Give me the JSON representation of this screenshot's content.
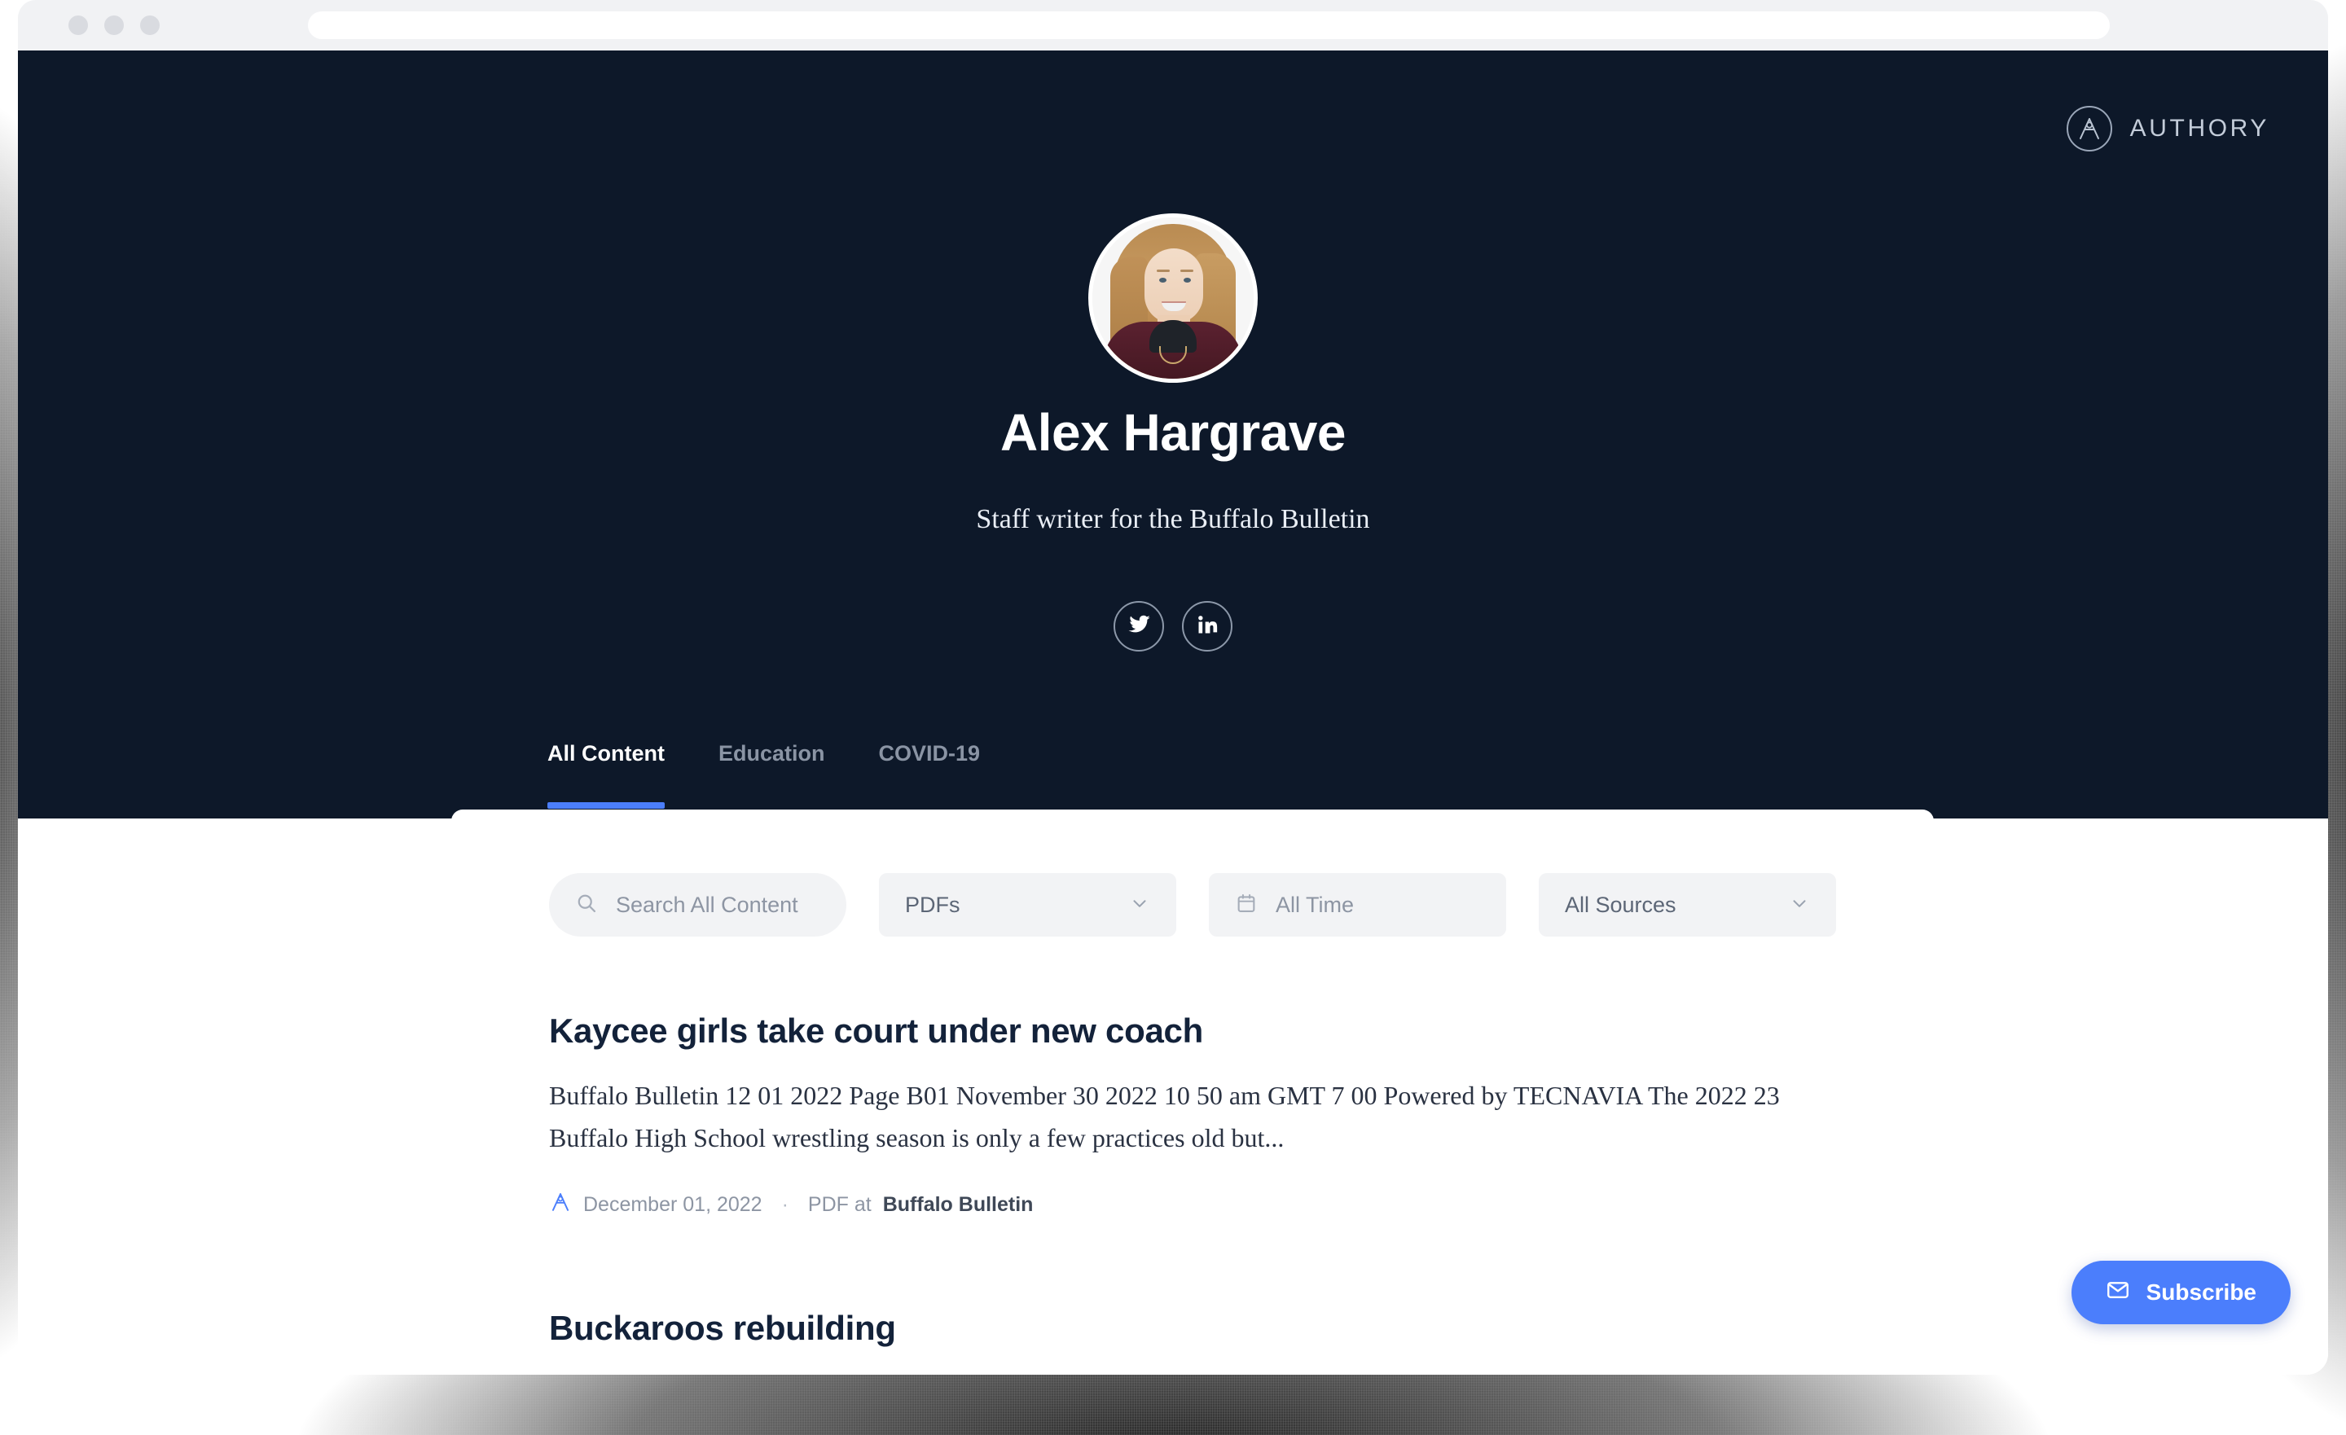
{
  "browser": {
    "traffic_lights": [
      "close",
      "minimize",
      "maximize"
    ],
    "url_value": ""
  },
  "brand": {
    "wordmark": "AUTHORY",
    "logo_icon": "authory-compass-icon",
    "accent_color": "#4b7efc",
    "hero_background": "#0d1829"
  },
  "profile": {
    "avatar_alt": "Alex Hargrave portrait",
    "name": "Alex Hargrave",
    "tagline": "Staff writer for the Buffalo Bulletin",
    "socials": [
      {
        "network": "twitter",
        "icon": "twitter-icon"
      },
      {
        "network": "linkedin",
        "icon": "linkedin-icon"
      }
    ]
  },
  "tabs": [
    {
      "label": "All Content",
      "active": true
    },
    {
      "label": "Education",
      "active": false
    },
    {
      "label": "COVID-19",
      "active": false
    }
  ],
  "filters": {
    "search": {
      "icon": "search-icon",
      "placeholder": "Search All Content",
      "value": ""
    },
    "content_type": {
      "value": "PDFs",
      "chevron_icon": "chevron-down-icon"
    },
    "time_range": {
      "icon": "calendar-icon",
      "value": "All Time"
    },
    "sources": {
      "value": "All Sources",
      "chevron_icon": "chevron-down-icon"
    }
  },
  "articles": [
    {
      "title": "Kaycee girls take court under new coach",
      "excerpt": "Buffalo Bulletin 12 01 2022 Page B01 November 30 2022 10 50 am GMT 7 00 Powered by TECNAVIA The 2022 23 Buffalo High School wrestling season is only a few practices old but...",
      "meta_icon": "authory-compass-icon",
      "date": "December 01, 2022",
      "separator": "·",
      "type_prefix": "PDF at",
      "source": "Buffalo Bulletin"
    },
    {
      "title": "Buckaroos rebuilding",
      "excerpt": "",
      "meta_icon": "authory-compass-icon",
      "date": "",
      "separator": "",
      "type_prefix": "",
      "source": ""
    }
  ],
  "subscribe": {
    "icon": "envelope-icon",
    "label": "Subscribe"
  }
}
